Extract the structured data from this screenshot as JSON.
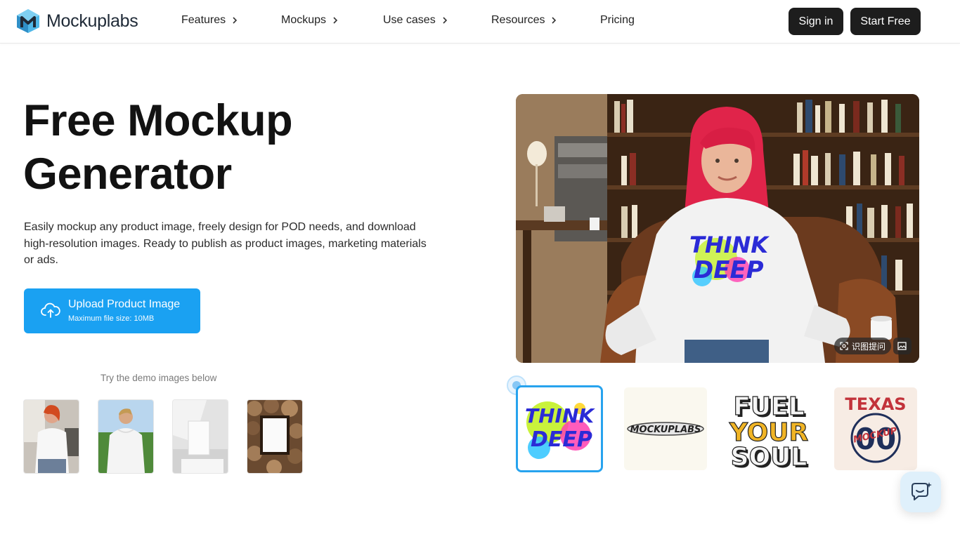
{
  "brand": {
    "name": "Mockuplabs",
    "accent": "#1aa1f2",
    "dark": "#1d1d1d"
  },
  "nav": {
    "items": [
      {
        "label": "Features",
        "has_chevron": true
      },
      {
        "label": "Mockups",
        "has_chevron": true
      },
      {
        "label": "Use cases",
        "has_chevron": true
      },
      {
        "label": "Resources",
        "has_chevron": true
      },
      {
        "label": "Pricing",
        "has_chevron": false
      }
    ],
    "sign_in": "Sign in",
    "start_free": "Start Free"
  },
  "hero": {
    "title_line1": "Free Mockup",
    "title_line2": "Generator",
    "description": "Easily mockup any product image, freely design for POD needs, and download high-resolution images. Ready to publish as product images, marketing materials or ads.",
    "upload_label": "Upload Product Image",
    "upload_sub": "Maximum file size: 10MB",
    "demo_hint": "Try the demo images below",
    "demo_images": [
      "woman-white-tshirt",
      "man-white-hoodie",
      "blank-card-on-box",
      "frame-on-log-wall"
    ]
  },
  "preview": {
    "image": "woman-red-hair-sweatshirt-library",
    "overlay_chip": "识图提问",
    "designs": [
      {
        "name": "think-deep",
        "line1": "THINK",
        "line2": "DEEP",
        "selected": true
      },
      {
        "name": "mockuplabs-logo",
        "text": "MOCKUPLABS",
        "selected": false
      },
      {
        "name": "fuel-your-soul",
        "line1": "FUEL",
        "line2": "YOUR",
        "line3": "SOUL",
        "selected": false
      },
      {
        "name": "texas-varsity",
        "line1": "TEXAS",
        "number": "00",
        "center": "MOCKUP",
        "selected": false
      }
    ]
  },
  "chat_widget": {
    "icon": "chat-bubble-icon"
  }
}
